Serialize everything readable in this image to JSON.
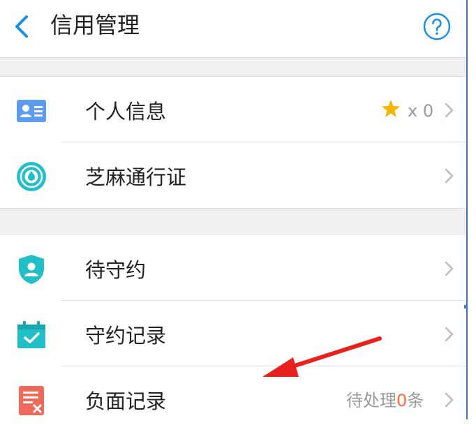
{
  "header": {
    "title": "信用管理",
    "back_icon": "chevron-left-icon",
    "help_icon": "question-circle-icon"
  },
  "colors": {
    "accent": "#1a8fe8",
    "teal": "#21c0c8",
    "star": "#f5b400",
    "negative": "#f06a5a",
    "highlight": "#ff6a3a",
    "annotation_arrow": "#e8201e"
  },
  "section1": {
    "items": [
      {
        "label": "个人信息",
        "icon": "id-card-icon",
        "star_count": "x 0"
      },
      {
        "label": "芝麻通行证",
        "icon": "sesame-pass-icon"
      }
    ]
  },
  "section2": {
    "items": [
      {
        "label": "待守约",
        "icon": "shield-user-icon"
      },
      {
        "label": "守约记录",
        "icon": "calendar-check-icon"
      },
      {
        "label": "负面记录",
        "icon": "document-x-icon",
        "status_prefix": "待处理",
        "status_count": "0",
        "status_suffix": "条"
      }
    ]
  }
}
